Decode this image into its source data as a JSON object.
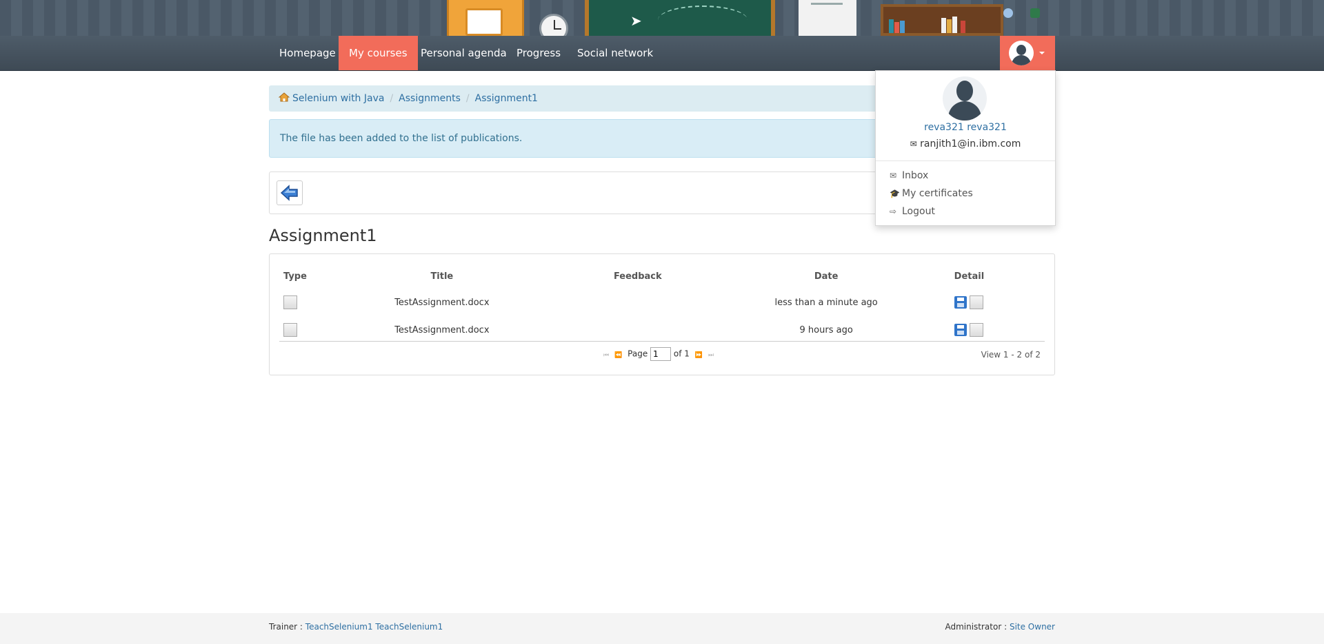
{
  "nav": {
    "items": [
      {
        "label": "Homepage",
        "active": false
      },
      {
        "label": "My courses",
        "active": true
      },
      {
        "label": "Personal agenda",
        "active": false
      },
      {
        "label": "Progress",
        "active": false
      },
      {
        "label": "Social network",
        "active": false
      }
    ],
    "accent_color": "#f26c5a"
  },
  "user_menu": {
    "name": "reva321 reva321",
    "email": "ranjith1@in.ibm.com",
    "links": [
      {
        "label": "Inbox",
        "icon": "envelope-icon"
      },
      {
        "label": "My certificates",
        "icon": "graduation-cap-icon"
      },
      {
        "label": "Logout",
        "icon": "sign-out-icon"
      }
    ]
  },
  "breadcrumb": [
    "Selenium with Java",
    "Assignments",
    "Assignment1"
  ],
  "alert": {
    "message": "The file has been added to the list of publications."
  },
  "page_title": "Assignment1",
  "table": {
    "columns": [
      "Type",
      "Title",
      "Feedback",
      "Date",
      "Detail"
    ],
    "rows": [
      {
        "title": "TestAssignment.docx",
        "feedback": "",
        "date": "less than a minute ago"
      },
      {
        "title": "TestAssignment.docx",
        "feedback": "",
        "date": "9 hours ago"
      }
    ]
  },
  "pager": {
    "page_label": "Page",
    "page_value": "1",
    "of_label": "of 1",
    "view_text": "View 1 - 2 of 2"
  },
  "footer": {
    "trainer_label": "Trainer :",
    "trainer_name": "TeachSelenium1 TeachSelenium1",
    "admin_label": "Administrator :",
    "admin_name": "Site Owner"
  }
}
